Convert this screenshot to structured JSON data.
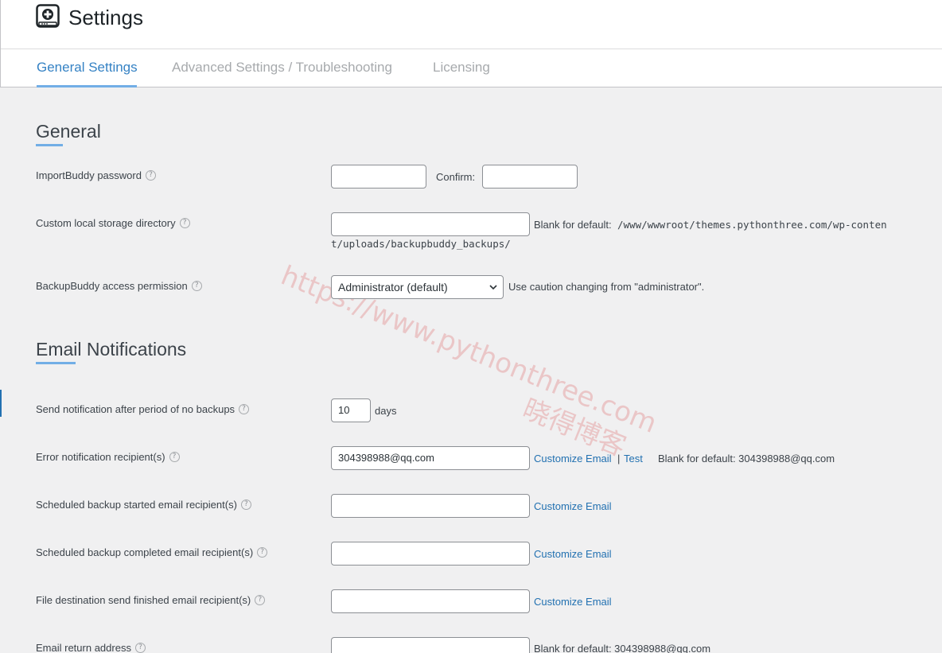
{
  "header": {
    "title": "Settings",
    "icon": "backup-safe-icon"
  },
  "tabs": [
    {
      "label": "General Settings",
      "active": true
    },
    {
      "label": "Advanced Settings / Troubleshooting",
      "active": false
    },
    {
      "label": "Licensing",
      "active": false
    }
  ],
  "general": {
    "title": "General",
    "importbuddy_password": {
      "label": "ImportBuddy password",
      "value": "",
      "confirm_label": "Confirm:",
      "confirm_value": ""
    },
    "storage_dir": {
      "label": "Custom local storage directory",
      "value": "",
      "hint": "Blank for default:",
      "default_path_line1": "/www/wwwroot/themes.pythonthree.com/wp-conten",
      "default_path_line2": "t/uploads/backupbuddy_backups/"
    },
    "access_permission": {
      "label": "BackupBuddy access permission",
      "selected": "Administrator (default)",
      "hint": "Use caution changing from \"administrator\"."
    }
  },
  "email": {
    "title": "Email Notifications",
    "no_backup_period": {
      "label": "Send notification after period of no backups",
      "value": "10",
      "unit": "days"
    },
    "error_recipient": {
      "label": "Error notification recipient(s)",
      "value": "304398988@qq.com",
      "customize": "Customize Email",
      "separator": "|",
      "test": "Test",
      "hint": "Blank for default: 304398988@qq.com"
    },
    "started_recipient": {
      "label": "Scheduled backup started email recipient(s)",
      "value": "",
      "customize": "Customize Email"
    },
    "completed_recipient": {
      "label": "Scheduled backup completed email recipient(s)",
      "value": "",
      "customize": "Customize Email"
    },
    "destination_recipient": {
      "label": "File destination send finished email recipient(s)",
      "value": "",
      "customize": "Customize Email"
    },
    "return_address": {
      "label": "Email return address",
      "value": "",
      "hint": "Blank for default: 304398988@qq.com"
    }
  },
  "watermark": {
    "url": "https://www.pythonthree.com",
    "cn": "晓得博客"
  },
  "help_glyph": "?",
  "colors": {
    "accent": "#72aee6",
    "link": "#2271b1",
    "background": "#f0f0f1"
  }
}
